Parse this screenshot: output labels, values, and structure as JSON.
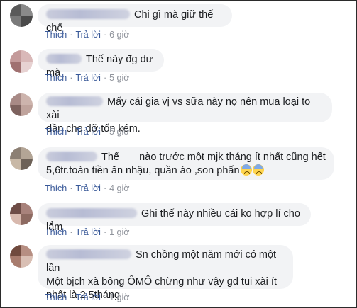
{
  "actions": {
    "like": "Thích",
    "reply": "Trả lời",
    "dot": "·"
  },
  "comments": [
    {
      "text": "Chi gì mà giữ thế chế",
      "time": "6 giờ"
    },
    {
      "text": "Thế này đg dư mà",
      "time": "5 giờ"
    },
    {
      "text_line1": "Mấy cái gia vị vs sữa này nọ nên mua loại to xài",
      "text_line2": "dần cho đỡ tốn kém.",
      "time": "5 giờ"
    },
    {
      "text_line1": "Thế       nào trước một mjk tháng ít nhất cũng hết",
      "text_line2": "5,6tr.toàn tiền ăn nhậu, quần áo ,son phấn",
      "emoji": "fearful-face-emoji",
      "time": "4 giờ"
    },
    {
      "text": "Ghi thế này nhiều cái ko hợp lí cho lắm",
      "time": "1 giờ"
    },
    {
      "text_line1": "Sn chồng một năm mới có một lần",
      "text_line2": "Một bịch xà bông ÔMÔ chừng như vậy gd tui xài ít",
      "text_line3": "nhất là 2,5tháng",
      "time": "1 giờ"
    }
  ],
  "colors": {
    "bubble": "#f2f3f5",
    "link": "#385898",
    "meta": "#90949c"
  }
}
